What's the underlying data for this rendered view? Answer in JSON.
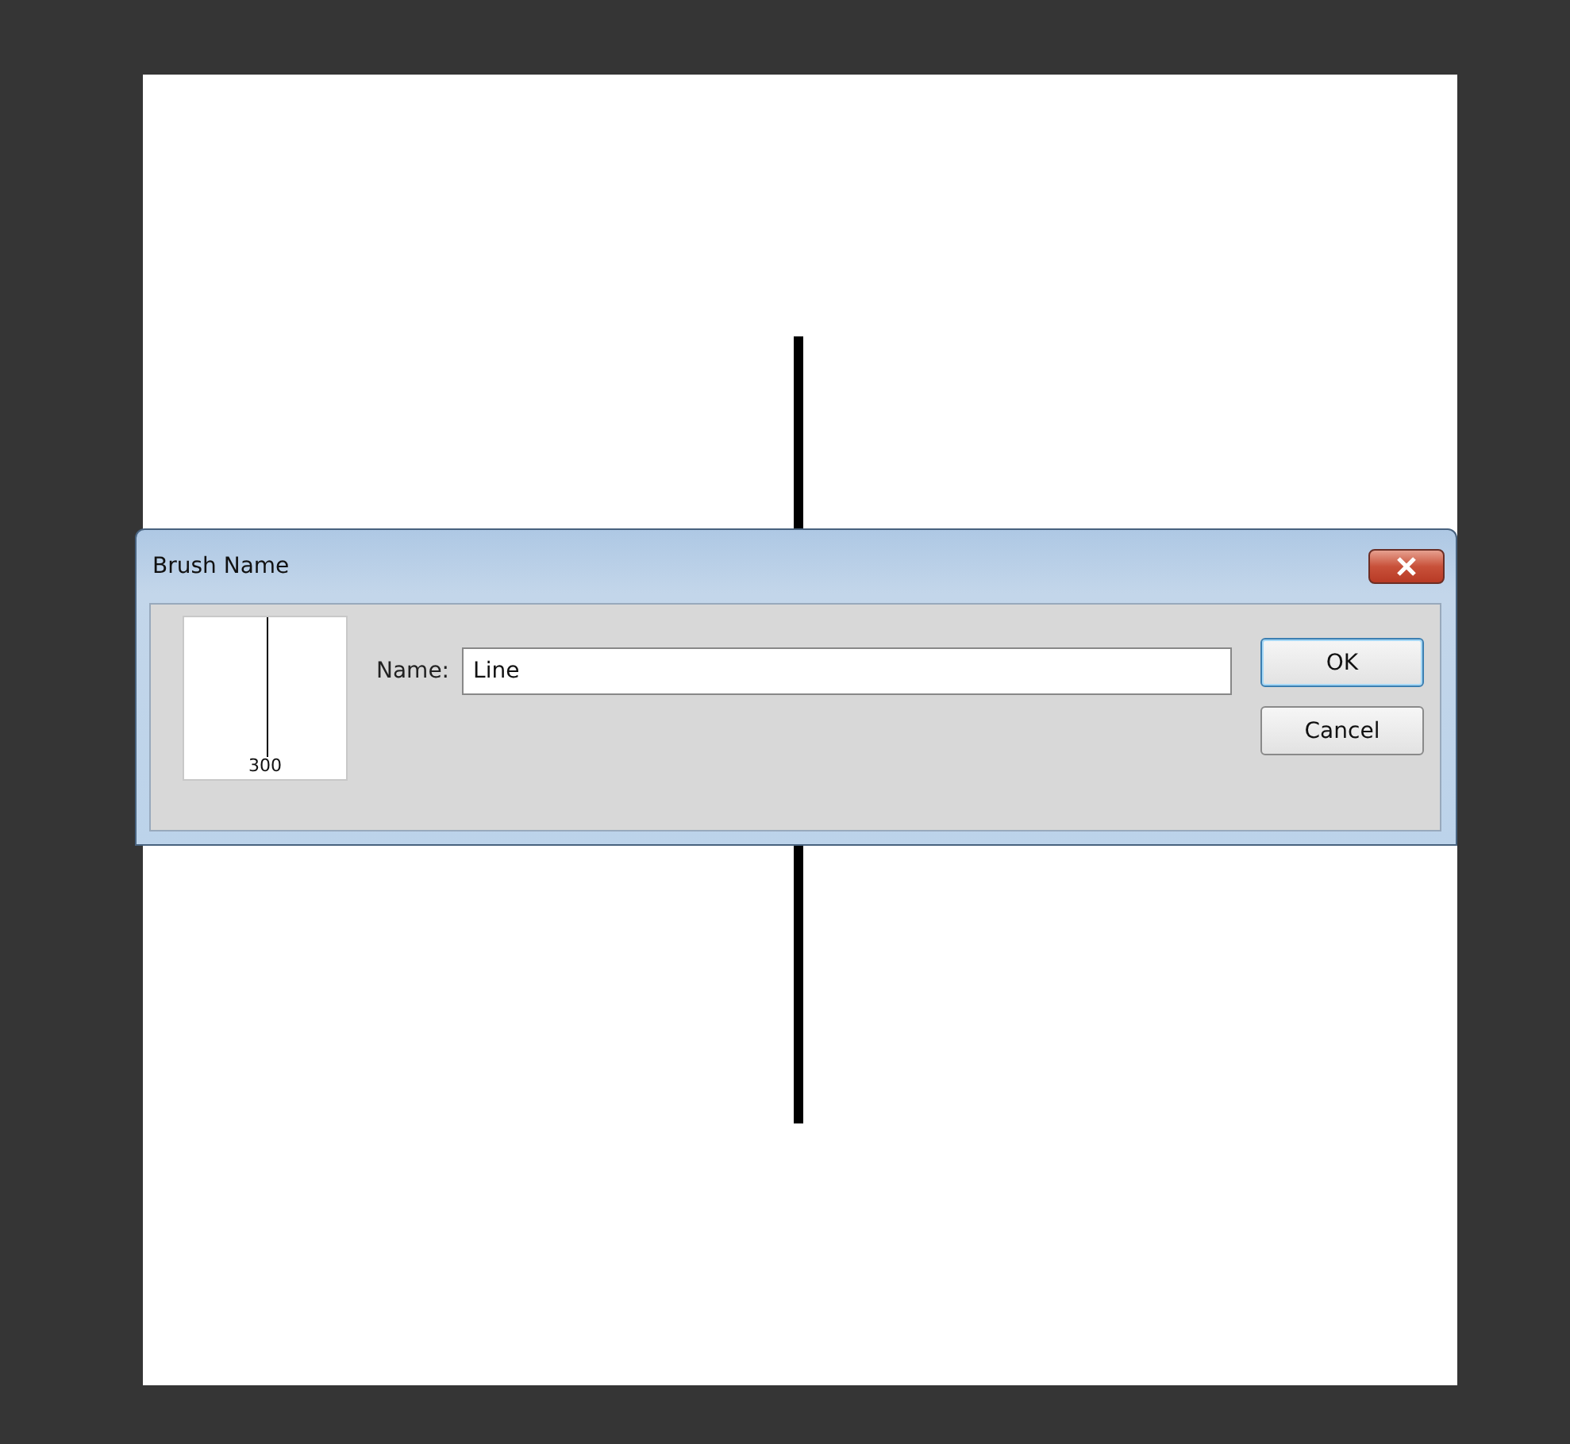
{
  "dialog": {
    "title": "Brush Name",
    "preview": {
      "size": "300"
    },
    "name_field": {
      "label": "Name:",
      "value": "Line"
    },
    "buttons": [
      {
        "label": "OK",
        "default": true
      },
      {
        "label": "Cancel",
        "default": false
      }
    ]
  }
}
